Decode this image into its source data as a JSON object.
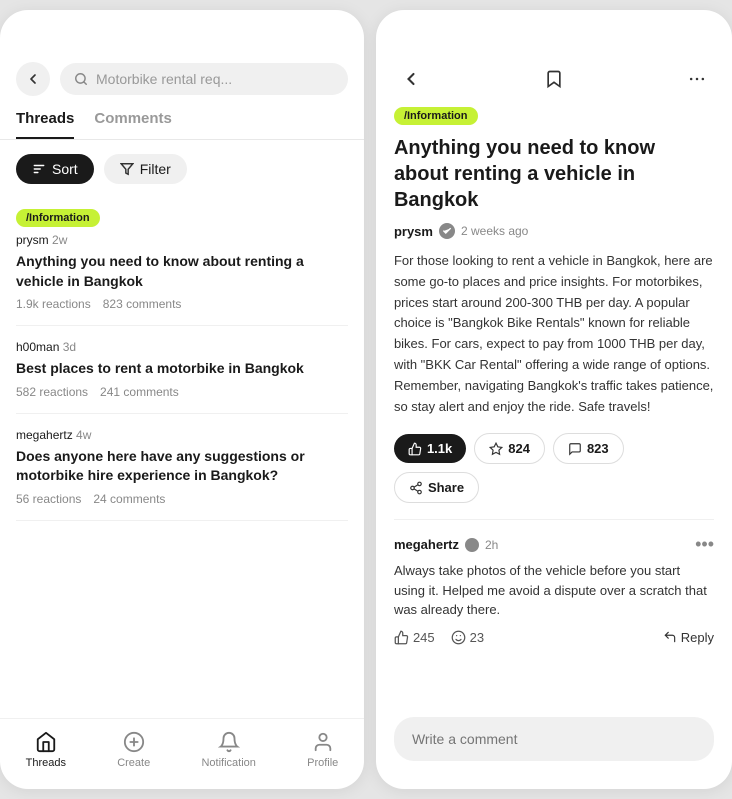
{
  "left": {
    "search_placeholder": "Motorbike rental req...",
    "back_icon": "←",
    "tabs": [
      {
        "label": "Threads",
        "active": true
      },
      {
        "label": "Comments",
        "active": false
      }
    ],
    "sort_label": "Sort",
    "filter_label": "Filter",
    "threads": [
      {
        "tag": "/Information",
        "username": "prysm",
        "time": "2w",
        "title": "Anything you need to know about renting a vehicle in Bangkok",
        "reactions": "1.9k reactions",
        "comments": "823 comments"
      },
      {
        "tag": null,
        "username": "h00man",
        "time": "3d",
        "title": "Best places to rent a motorbike in Bangkok",
        "reactions": "582 reactions",
        "comments": "241 comments"
      },
      {
        "tag": null,
        "username": "megahertz",
        "time": "4w",
        "title": "Does anyone here have any suggestions or motorbike hire experience in Bangkok?",
        "reactions": "56 reactions",
        "comments": "24 comments"
      }
    ],
    "nav": [
      {
        "label": "Threads",
        "active": true
      },
      {
        "label": "Create",
        "active": false
      },
      {
        "label": "Notification",
        "active": false
      },
      {
        "label": "Profile",
        "active": false
      }
    ]
  },
  "right": {
    "post": {
      "tag": "/Information",
      "title": "Anything you need to know about renting a vehicle in Bangkok",
      "author": "prysm",
      "time": "2 weeks ago",
      "body": "For those looking to rent a vehicle in Bangkok, here are some go-to places and price insights. For motorbikes, prices start around 200-300 THB per day. A popular choice is \"Bangkok Bike Rentals\" known for reliable bikes. For cars, expect to pay from 1000 THB per day, with \"BKK Car Rental\" offering a wide range of options. Remember, navigating Bangkok's traffic takes patience, so stay alert and enjoy the ride. Safe travels!",
      "likes": "1.1k",
      "stars": "824",
      "comments": "823",
      "share_label": "Share"
    },
    "comment": {
      "author": "megahertz",
      "time": "2h",
      "body": "Always take photos of the vehicle before you start using it. Helped me avoid a dispute over a scratch that was already there.",
      "likes": "245",
      "dislikes": "23",
      "reply_label": "Reply"
    },
    "comment_placeholder": "Write a comment"
  }
}
